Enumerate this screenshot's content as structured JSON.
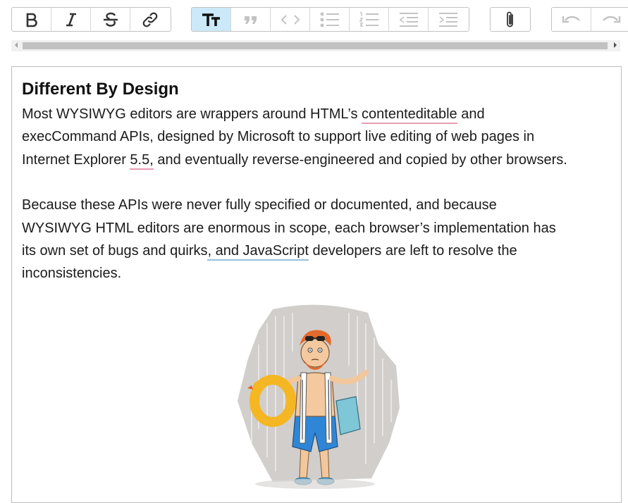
{
  "toolbar": {
    "text_group": [
      {
        "name": "bold-button",
        "icon": "bold-icon"
      },
      {
        "name": "italic-button",
        "icon": "italic-icon"
      },
      {
        "name": "strikethrough-button",
        "icon": "strikethrough-icon"
      },
      {
        "name": "link-button",
        "icon": "link-icon"
      }
    ],
    "block_group": [
      {
        "name": "heading-button",
        "icon": "heading-icon",
        "active": true
      },
      {
        "name": "quote-button",
        "icon": "quote-icon"
      },
      {
        "name": "code-button",
        "icon": "code-icon"
      },
      {
        "name": "bullet-list-button",
        "icon": "bullet-list-icon"
      },
      {
        "name": "numbered-list-button",
        "icon": "numbered-list-icon"
      },
      {
        "name": "decrease-indent-button",
        "icon": "outdent-icon"
      },
      {
        "name": "increase-indent-button",
        "icon": "indent-icon"
      }
    ],
    "file_group": [
      {
        "name": "attach-file-button",
        "icon": "paperclip-icon"
      }
    ],
    "history_group": [
      {
        "name": "undo-button",
        "icon": "undo-icon"
      },
      {
        "name": "redo-button",
        "icon": "redo-icon"
      }
    ],
    "active_color": "#cbe9f8"
  },
  "document": {
    "heading": "Different By Design",
    "paragraph1": {
      "line1_a": "Most WYSIWYG editors are wrappers around HTML’s ",
      "line1_misspelled": "contenteditable",
      "line1_b": " and",
      "line2": "execCommand APIs, designed by Microsoft to support live editing of web pages in",
      "line3_a": "Internet Explorer ",
      "line3_flagged": "5.5,",
      "line3_b": " and eventually reverse-engineered and copied by other browsers."
    },
    "paragraph2": {
      "line1": "Because these APIs were never fully specified or documented, and because",
      "line2": "WYSIWYG HTML editors are enormous in scope, each browser’s implementation has",
      "line3_a": "its own set of bugs and quirks",
      "line3_grammar": ", and JavaScript",
      "line3_b": " developers are left to resolve the",
      "line4": "inconsistencies."
    },
    "image": {
      "icon": "man-in-rain-illustration"
    },
    "spellcheck_color": "#e79cb0",
    "grammar_color": "#98bfe0"
  }
}
